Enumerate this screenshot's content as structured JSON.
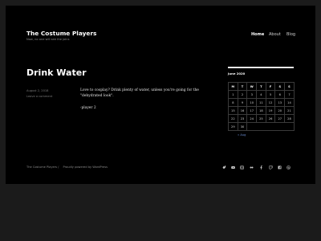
{
  "header": {
    "site_title": "The Costume Players",
    "site_description": "Now, no one will see the joins"
  },
  "nav": {
    "items": [
      {
        "label": "Home",
        "active": true
      },
      {
        "label": "About",
        "active": false
      },
      {
        "label": "Blog",
        "active": false
      }
    ]
  },
  "post": {
    "title": "Drink Water",
    "date": "August 2, 2018",
    "comment_link": "Leave a comment",
    "paragraph1": "Love to cosplay? Drink plenty of water, unless you're going for the \"dehydrated look\".",
    "paragraph2": "-player 2"
  },
  "calendar": {
    "title": "June 2020",
    "weekdays": [
      "M",
      "T",
      "W",
      "T",
      "F",
      "S",
      "S"
    ],
    "weeks": [
      [
        "1",
        "2",
        "3",
        "4",
        "5",
        "6",
        "7"
      ],
      [
        "8",
        "9",
        "10",
        "11",
        "12",
        "13",
        "14"
      ],
      [
        "15",
        "16",
        "17",
        "18",
        "19",
        "20",
        "21"
      ],
      [
        "22",
        "23",
        "24",
        "25",
        "26",
        "27",
        "28"
      ],
      [
        "29",
        "30",
        "",
        "",
        "",
        "",
        ""
      ]
    ],
    "prev_link": "« Aug"
  },
  "footer": {
    "site_name": "The Costume Players",
    "separator": "/",
    "powered_by": "Proudly powered by WordPress",
    "social_icons": [
      "twitter-icon",
      "youtube-icon",
      "instagram-icon",
      "flickr-icon",
      "facebook-icon",
      "twitch-icon",
      "facebook-square-icon",
      "wordpress-icon"
    ]
  },
  "colors": {
    "background": "#1b1b1b",
    "panel": "#000000",
    "link": "#6d8fd6",
    "text": "#ffffff"
  }
}
